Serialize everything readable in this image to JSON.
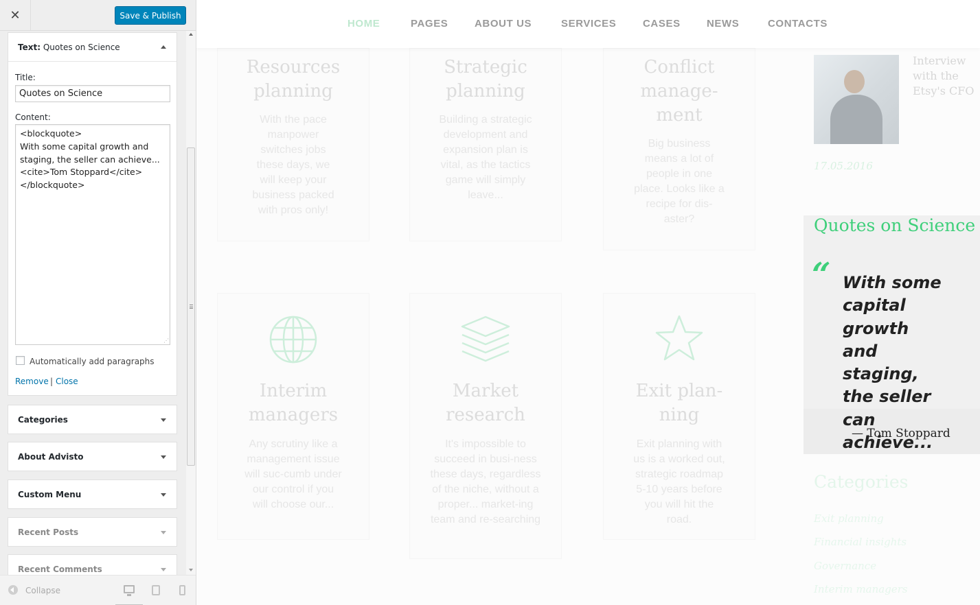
{
  "panel": {
    "close_icon": "close-icon",
    "publish_label": "Save & Publish",
    "active_widget": {
      "type_label": "Text:",
      "name": "Quotes on Science",
      "title_label": "Title:",
      "title_value": "Quotes on Science",
      "content_label": "Content:",
      "content_value": "<blockquote>\nWith some capital growth and staging, the seller can achieve...\n<cite>Tom Stoppard</cite>\n</blockquote>",
      "auto_paragraphs_label": "Automatically add paragraphs",
      "auto_paragraphs_checked": false,
      "remove_label": "Remove",
      "separator": "|",
      "close_label": "Close"
    },
    "widgets": [
      {
        "title": "Categories"
      },
      {
        "title": "About Advisto"
      },
      {
        "title": "Custom Menu"
      },
      {
        "title": "Recent Posts"
      },
      {
        "title": "Recent Comments"
      }
    ],
    "footer": {
      "collapse_label": "Collapse",
      "devices": [
        "desktop-icon",
        "tablet-icon",
        "mobile-icon"
      ]
    }
  },
  "site": {
    "nav": [
      "HOME",
      "PAGES",
      "ABOUT US",
      "SERVICES",
      "CASES",
      "NEWS",
      "CONTACTS"
    ],
    "nav_active": "HOME",
    "cards": [
      {
        "title": "Resources planning",
        "text": "With the pace manpower switches jobs these days, we will keep your business packed with pros only!"
      },
      {
        "title": "Strategic planning",
        "text": "Building a strategic development and expansion plan is vital, as the tactics game will simply leave..."
      },
      {
        "title": "Conflict manage-ment",
        "text": "Big business means a lot of people in one place. Looks like a recipe for dis-aster?"
      },
      {
        "title": "Interim managers",
        "icon": "globe-icon",
        "text": "Any scrutiny like a management issue will suc-cumb under our control if you will choose our..."
      },
      {
        "title": "Market research",
        "icon": "layers-icon",
        "text": "It's impossible to succeed in busi-ness these days, regardless of the niche, without a proper... market-ing team and re-searching"
      },
      {
        "title": "Exit plan-ning",
        "icon": "star-icon",
        "text": "Exit planning with us is a worked out, strategic roadmap 5-10 years before you will hit the road."
      }
    ],
    "sidebar": {
      "post_title": "Interview with the Etsy's CFO",
      "post_date": "17.05.2016",
      "quote_widget_title": "Quotes on Science",
      "quote_text": "With some capital growth and staging, the seller can achieve...",
      "quote_cite": "— Tom Stoppard",
      "categories_title": "Categories",
      "categories": [
        "Exit planning",
        "Financial insights",
        "Governance",
        "Interim managers"
      ]
    }
  },
  "colors": {
    "accent_green": "#3ecf7a",
    "publish_blue": "#0085ba",
    "link_blue": "#0073aa"
  }
}
